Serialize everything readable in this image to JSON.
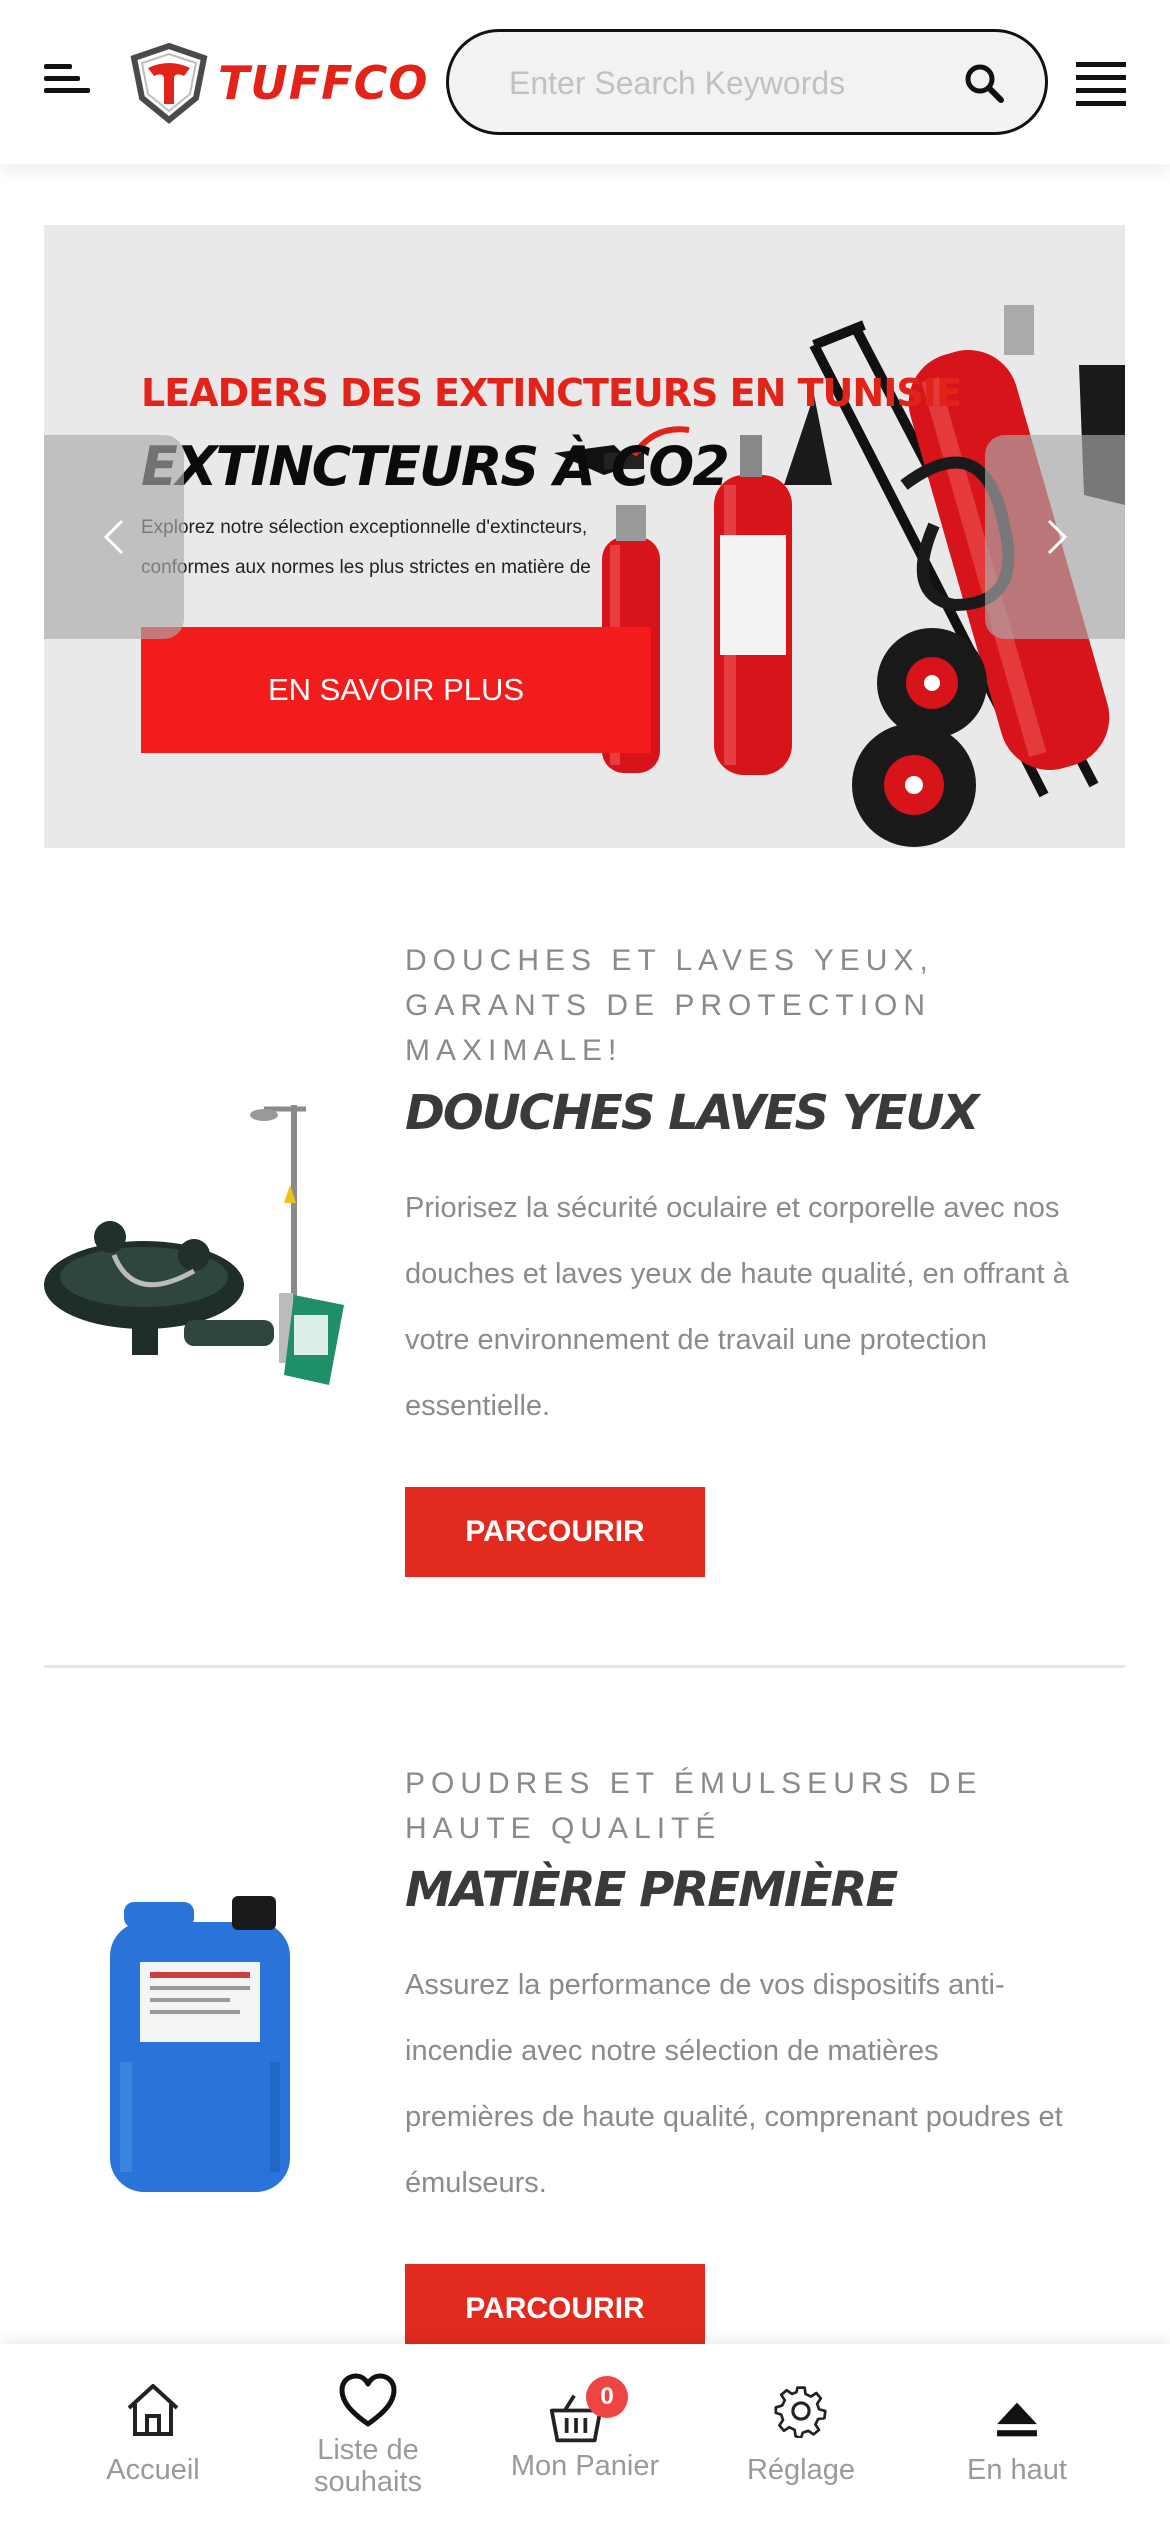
{
  "header": {
    "logo_text": "TUFFCO",
    "search_placeholder": "Enter Search Keywords"
  },
  "slider": {
    "kicker": "LEADERS DES EXTINCTEURS EN TUNISIE",
    "title": "EXTINCTEURS À CO2",
    "description": "Explorez notre sélection exceptionnelle d'extincteurs, conformes aux normes les plus strictes en matière de sécurité.",
    "cta": "EN SAVOIR PLUS"
  },
  "sections": [
    {
      "kicker": "DOUCHES ET LAVES YEUX, GARANTS DE PROTECTION MAXIMALE!",
      "title": "DOUCHES LAVES YEUX",
      "description": "Priorisez la sécurité oculaire et corporelle avec nos douches et laves yeux de haute qualité, en offrant à votre environnement de travail une protection essentielle.",
      "button": "PARCOURIR"
    },
    {
      "kicker": "POUDRES ET ÉMULSEURS DE HAUTE QUALITÉ",
      "title": "MATIÈRE PREMIÈRE",
      "description": "Assurez la performance de vos dispositifs anti-incendie avec notre sélection de matières premières de haute qualité, comprenant poudres et émulseurs.",
      "button": "PARCOURIR"
    }
  ],
  "bottom_nav": {
    "items": [
      {
        "label": "Accueil",
        "icon": "home-icon"
      },
      {
        "label": "Liste de souhaits",
        "icon": "heart-icon"
      },
      {
        "label": "Mon Panier",
        "icon": "basket-icon"
      },
      {
        "label": "Réglage",
        "icon": "gear-icon"
      },
      {
        "label": "En haut",
        "icon": "eject-icon"
      }
    ],
    "cart_count": "0"
  },
  "colors": {
    "brand_red": "#e2231a",
    "cta_red": "#f21c1c",
    "button_red": "#e22a1e",
    "badge_red": "#ee4444"
  }
}
